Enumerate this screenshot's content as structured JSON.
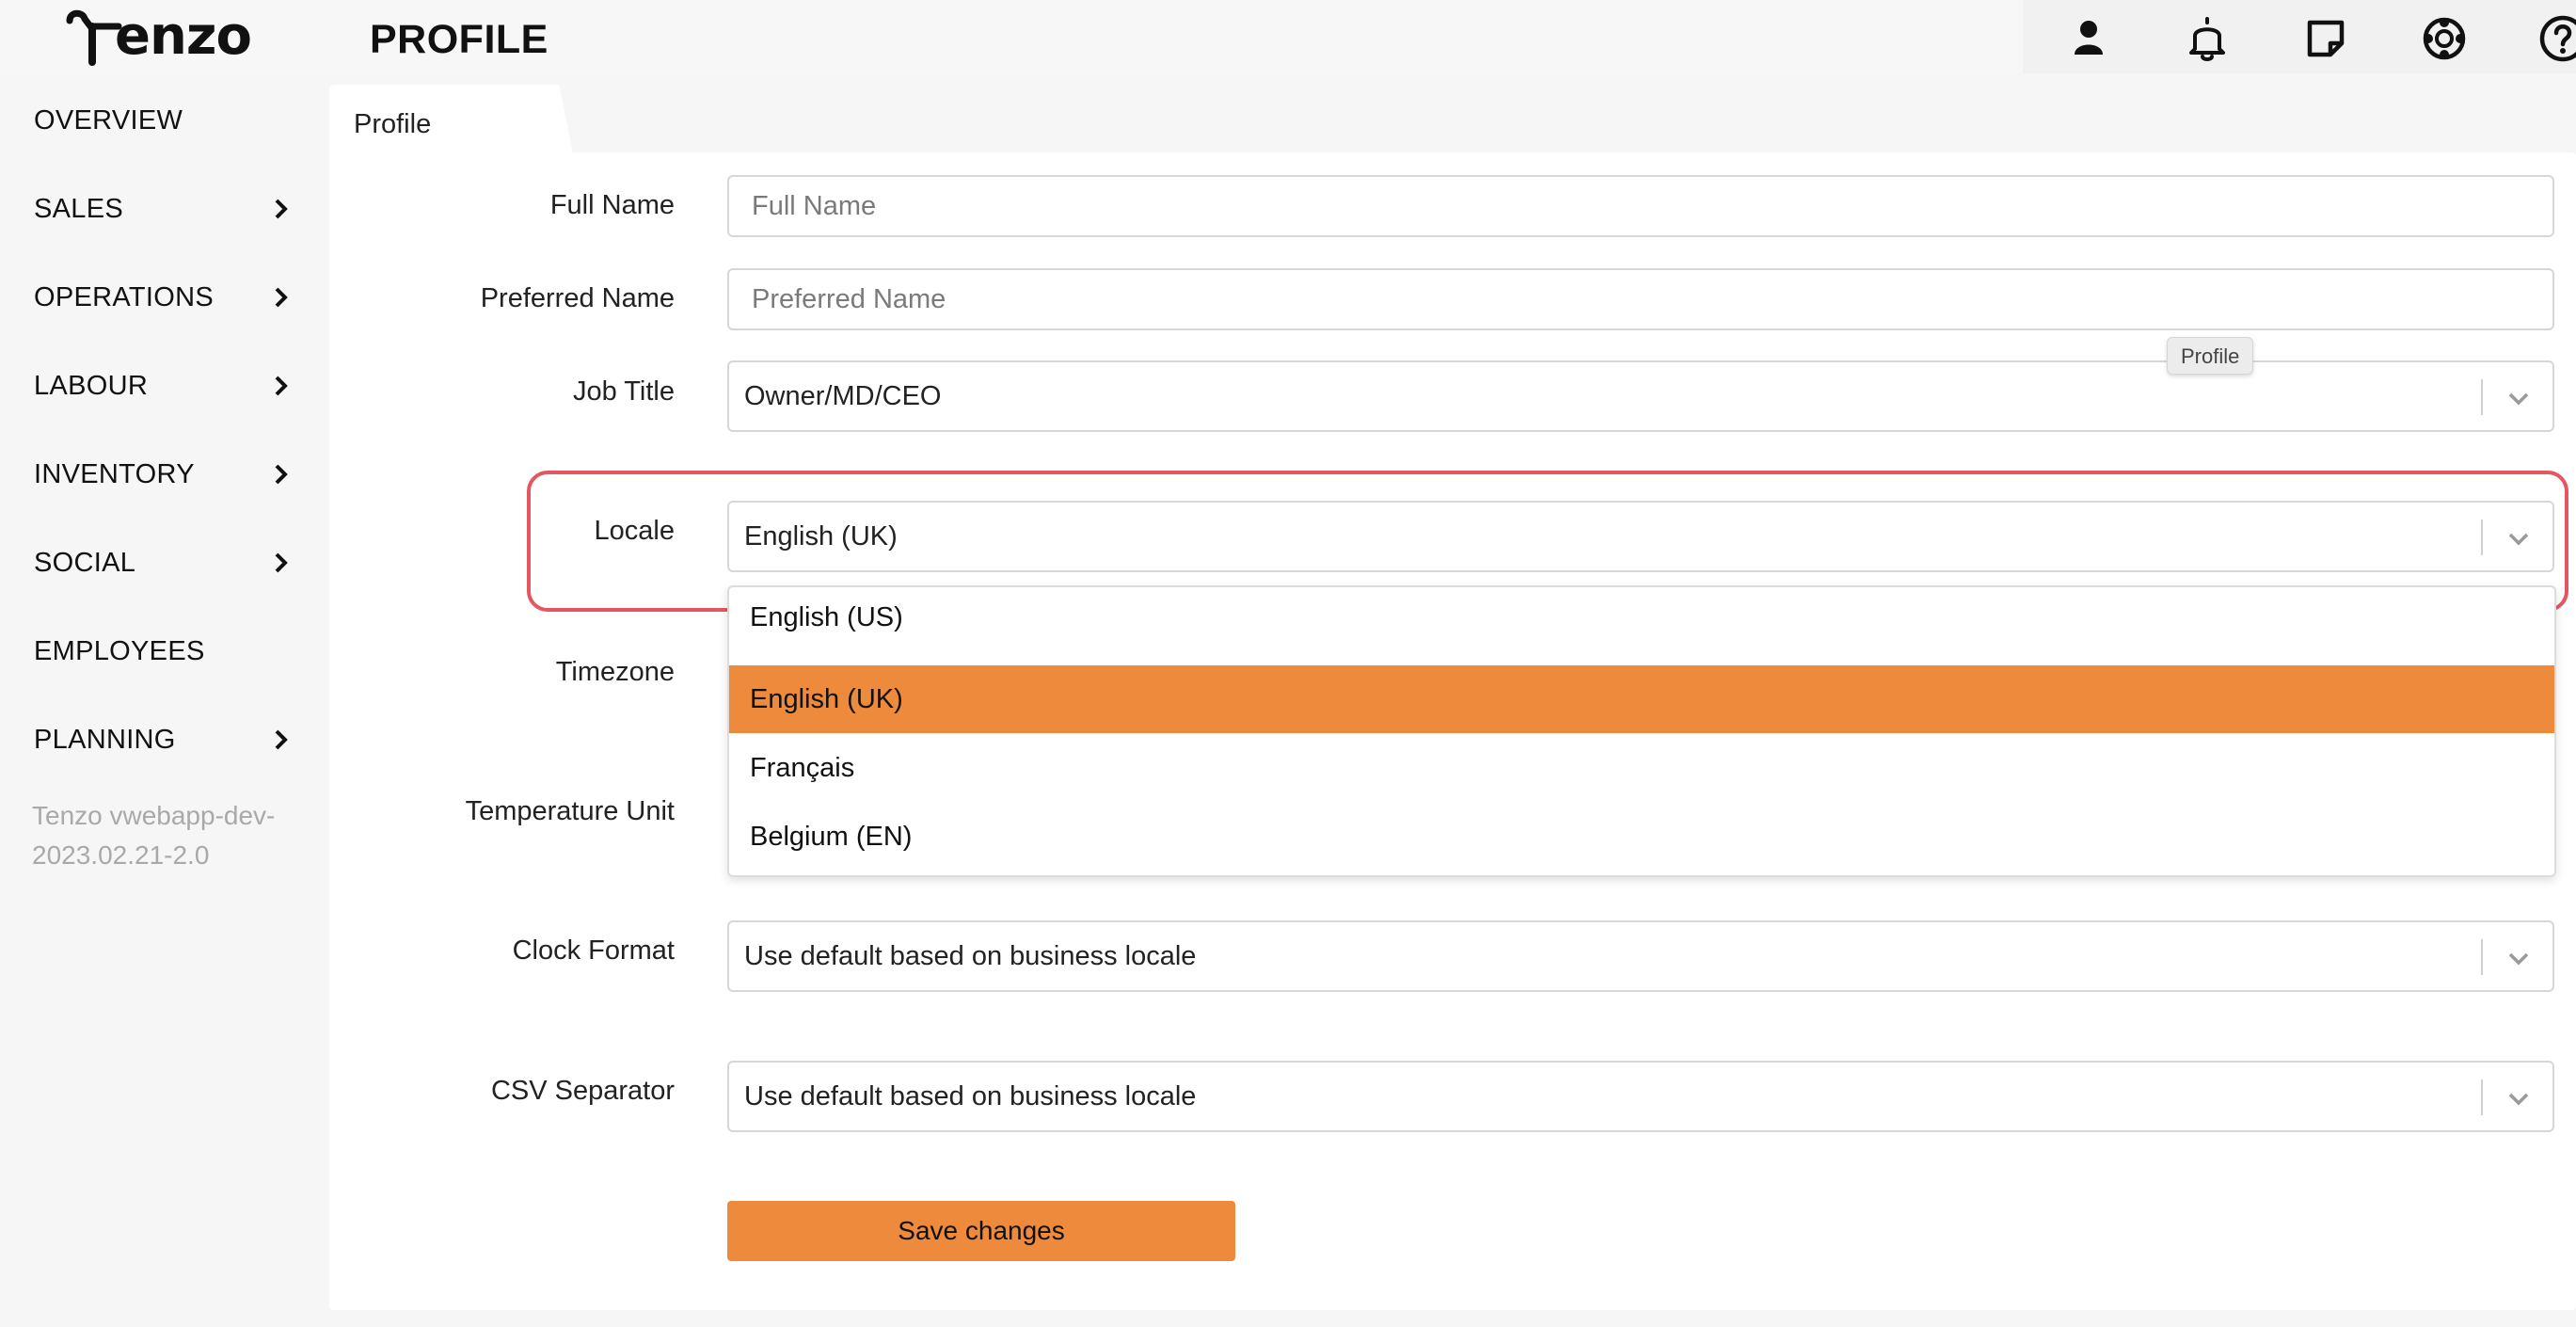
{
  "app": {
    "logo_text": "enzo",
    "page_title": "PROFILE"
  },
  "top_icons": [
    {
      "name": "user-icon"
    },
    {
      "name": "bell-icon"
    },
    {
      "name": "note-icon"
    },
    {
      "name": "support-icon"
    },
    {
      "name": "help-icon"
    }
  ],
  "sidebar": {
    "items": [
      {
        "label": "OVERVIEW",
        "has_chevron": false
      },
      {
        "label": "SALES",
        "has_chevron": true
      },
      {
        "label": "OPERATIONS",
        "has_chevron": true
      },
      {
        "label": "LABOUR",
        "has_chevron": true
      },
      {
        "label": "INVENTORY",
        "has_chevron": true
      },
      {
        "label": "SOCIAL",
        "has_chevron": true
      },
      {
        "label": "EMPLOYEES",
        "has_chevron": false
      },
      {
        "label": "PLANNING",
        "has_chevron": true
      }
    ],
    "version": "Tenzo vwebapp-dev-2023.02.21-2.0"
  },
  "tabs": {
    "active": "Profile"
  },
  "tooltip": "Profile",
  "form": {
    "full_name": {
      "label": "Full Name",
      "placeholder": "Full Name",
      "value": ""
    },
    "preferred_name": {
      "label": "Preferred Name",
      "placeholder": "Preferred Name",
      "value": ""
    },
    "job_title": {
      "label": "Job Title",
      "value": "Owner/MD/CEO"
    },
    "locale": {
      "label": "Locale",
      "value": "English (UK)"
    },
    "timezone": {
      "label": "Timezone"
    },
    "temperature_unit": {
      "label": "Temperature Unit"
    },
    "clock_format": {
      "label": "Clock Format",
      "value": "Use default based on business locale"
    },
    "csv_separator": {
      "label": "CSV Separator",
      "value": "Use default based on business locale"
    },
    "save_label": "Save changes"
  },
  "locale_dropdown": {
    "options": [
      "English (US)",
      "English (UK)",
      "Français",
      "Belgium (EN)"
    ],
    "selected": "English (UK)"
  },
  "colors": {
    "accent": "#ee8a3c",
    "highlight": "#e45762"
  }
}
